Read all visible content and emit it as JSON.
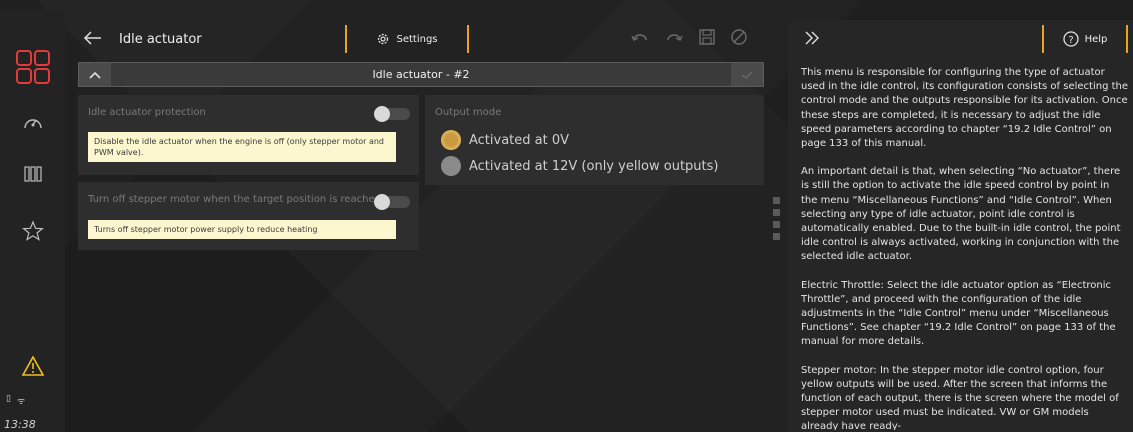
{
  "nav": {
    "items": [
      {
        "icon": "dashboard-grid-icon"
      },
      {
        "icon": "gauge-icon"
      },
      {
        "icon": "columns-icon"
      },
      {
        "icon": "star-icon"
      }
    ],
    "warning_icon": "warning-icon",
    "clock": "13:38",
    "accent_color": "#e6a420"
  },
  "header": {
    "title": "Idle actuator",
    "settings_label": "Settings"
  },
  "section": {
    "title": "Idle actuator - #2"
  },
  "cards": {
    "protection": {
      "label": "Idle actuator protection",
      "note": "Disable the idle actuator when the engine is off (only stepper motor and PWM valve)."
    },
    "stepper_off": {
      "label": "Turn off stepper motor when the target position is reached",
      "note": "Turns off stepper motor power supply to reduce heating"
    },
    "output_mode": {
      "label": "Output mode",
      "options": [
        {
          "label": "Activated at 0V",
          "selected": true
        },
        {
          "label": "Activated at 12V (only yellow outputs)",
          "selected": false
        }
      ]
    }
  },
  "help": {
    "button_label": "Help",
    "paragraphs": [
      "This menu is responsible for configuring the type of actuator used in the idle control, its configuration consists of selecting the control mode and the outputs responsible for its activation. Once these steps are completed, it is necessary to adjust the idle speed parameters according to chapter “19.2 Idle Control” on page 133 of this manual.",
      "An important detail is that, when selecting “No actuator”, there is still the option to activate the idle speed control by point in the menu “Miscellaneous Functions” and “Idle Control”. When selecting any type of idle actuator, point idle control is automatically enabled. Due to the built-in idle control, the point idle control is always activated, working in conjunction with the selected idle actuator.",
      "Electric Throttle: Select the idle actuator option as “Electronic Throttle”, and proceed with the configuration of the idle adjustments in the “Idle Control” menu under “Miscellaneous Functions”. See chapter “19.2 Idle Control” on page 133 of the manual for more details.",
      "Stepper motor: In the stepper motor idle control option, four yellow outputs will be used. After the screen that informs the function of each output, there is the screen where the model of stepper motor used must be indicated. VW or GM models already have ready-"
    ]
  }
}
